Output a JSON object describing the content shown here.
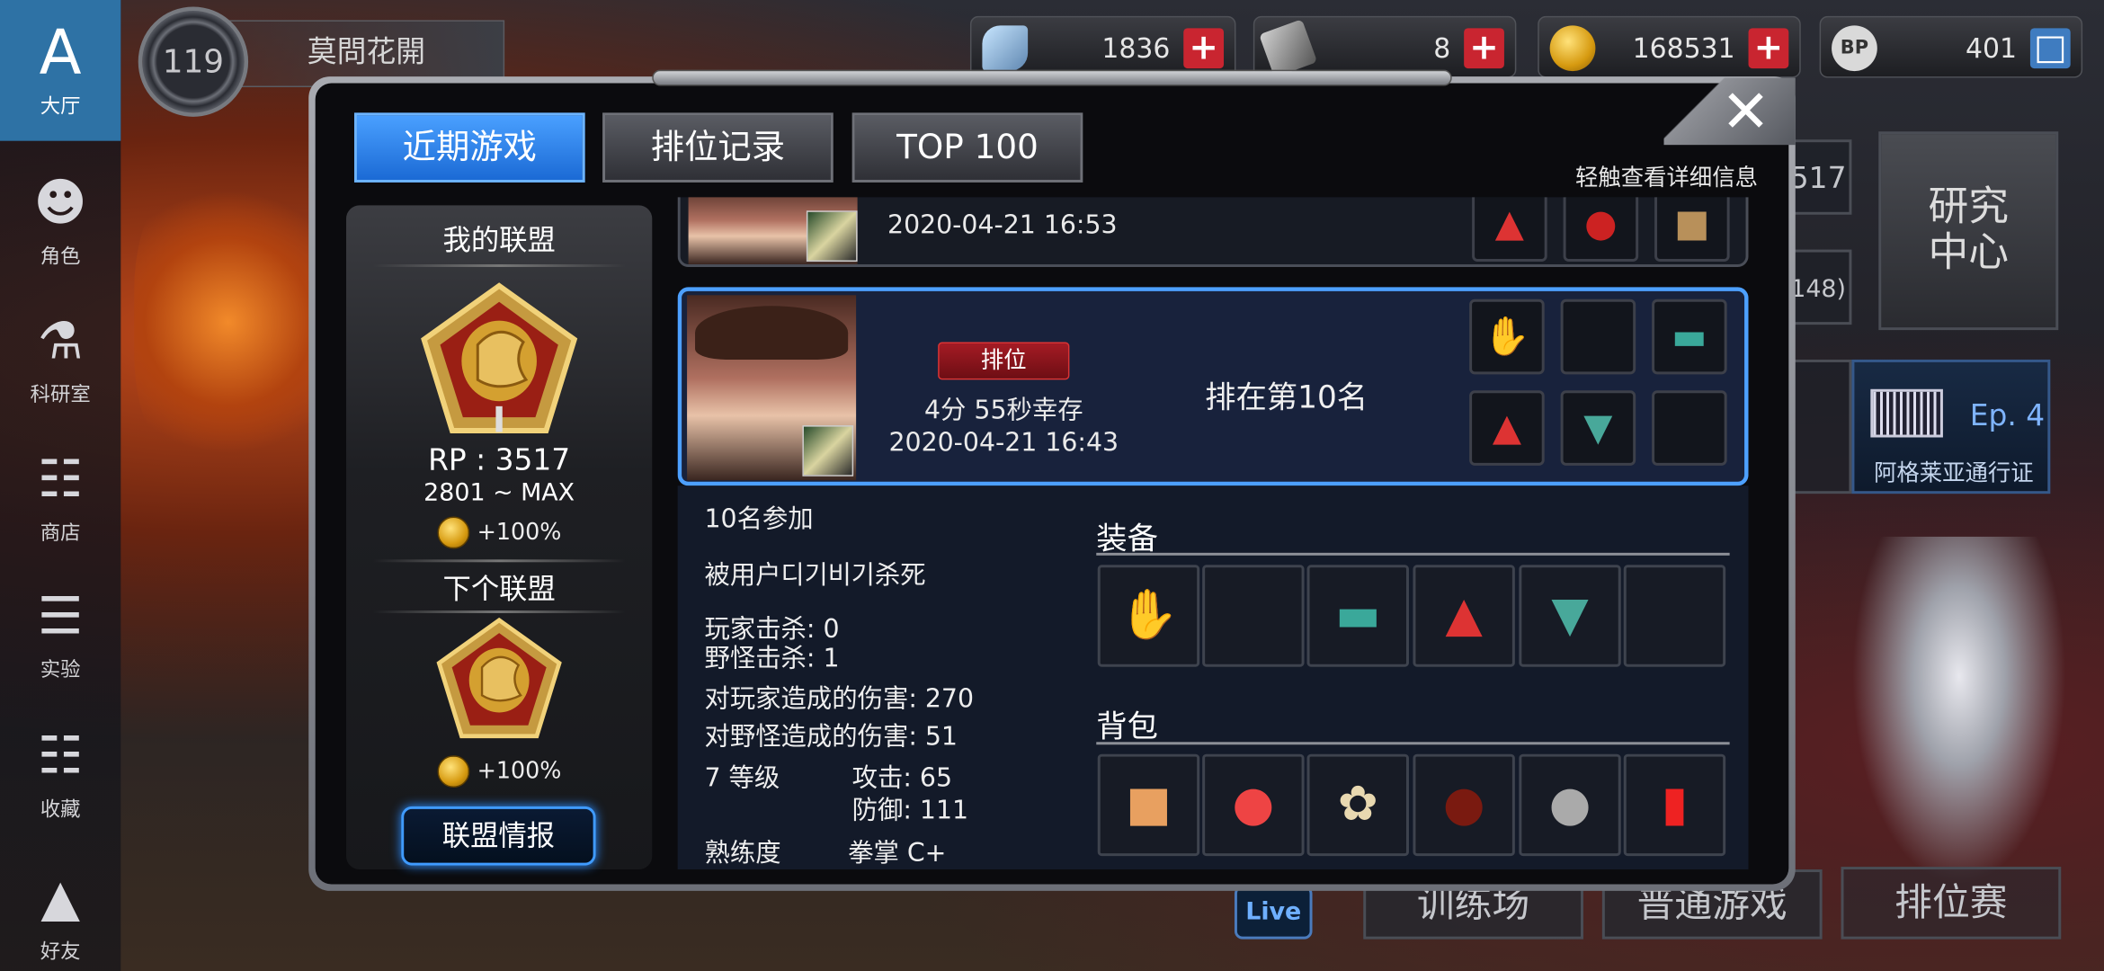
{
  "sidebar": {
    "items": [
      {
        "label": "大厅",
        "icon": "lobby-icon"
      },
      {
        "label": "角色",
        "icon": "character-icon"
      },
      {
        "label": "科研室",
        "icon": "flask-icon"
      },
      {
        "label": "商店",
        "icon": "cart-icon"
      },
      {
        "label": "实验",
        "icon": "books-icon"
      },
      {
        "label": "收藏",
        "icon": "book-icon"
      },
      {
        "label": "好友",
        "icon": "gamepad-icon"
      }
    ]
  },
  "header": {
    "level": "119",
    "player_name": "莫問花開",
    "resources": [
      {
        "name": "crystal",
        "value": "1836",
        "icon": "crystal-icon"
      },
      {
        "name": "drive",
        "value": "8",
        "icon": "drive-icon"
      },
      {
        "name": "coin",
        "value": "168531",
        "icon": "coin-icon"
      },
      {
        "name": "bp",
        "value": "401",
        "icon": "bp-icon",
        "icon_text": "BP"
      }
    ]
  },
  "background": {
    "research_center": "研究中心",
    "rp_partial": "517",
    "count_partial": "148)",
    "ep_label": "Ep. 4",
    "pass_label": "阿格莱亚通行证",
    "modes": [
      "训练场",
      "普通游戏",
      "排位赛"
    ],
    "live": "Live"
  },
  "dialog": {
    "tabs": [
      "近期游戏",
      "排位记录",
      "TOP 100"
    ],
    "active_tab": 0,
    "hint": "轻触查看详细信息",
    "close_symbol": "✕"
  },
  "league": {
    "my_title": "我的联盟",
    "tier_numeral": "I",
    "rp": "RP : 3517",
    "range": "2801 ~ MAX",
    "bonus": "+100%",
    "next_title": "下个联盟",
    "next_bonus": "+100%",
    "info_button": "联盟情报"
  },
  "matches": [
    {
      "time": "2020-04-21 16:53",
      "items": [
        "jacket-icon",
        "boots-icon",
        "box-icon"
      ]
    },
    {
      "tag": "排位",
      "survival": "4分 55秒幸存",
      "time": "2020-04-21 16:43",
      "rank": "排在第10名",
      "items": [
        "gloves-icon",
        "",
        "bracelet-icon",
        "jacket-icon",
        "shoes-icon",
        ""
      ]
    }
  ],
  "details": {
    "participants": "10名参加",
    "killed_by": "被用户디기비기杀死",
    "player_kills": "玩家击杀: 0",
    "monster_kills": "野怪击杀: 1",
    "damage_players": "对玩家造成的伤害: 270",
    "damage_monsters": "对野怪造成的伤害: 51",
    "level": "7 等级",
    "attack": "攻击: 65",
    "defense": "防御: 111",
    "proficiency_label": "熟练度",
    "proficiency_value": "拳掌  C+",
    "equipment_title": "装备",
    "equipment": [
      "gloves-icon",
      "",
      "bracelet-icon",
      "jacket-icon",
      "shoes-icon",
      ""
    ],
    "bag_title": "背包",
    "bag": [
      "chocolate-icon",
      "pills-icon",
      "feather-icon",
      "beetle-icon",
      "stone-icon",
      "lighter-icon"
    ]
  }
}
